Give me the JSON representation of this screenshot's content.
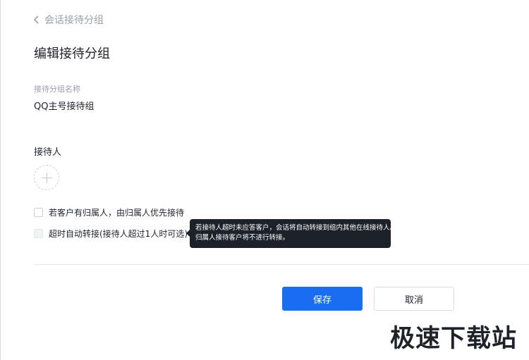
{
  "nav": {
    "back_label": "会话接待分组"
  },
  "page": {
    "title": "编辑接待分组"
  },
  "group_name": {
    "label": "接待分组名称",
    "value": "QQ主号接待组"
  },
  "receivers": {
    "label": "接待人"
  },
  "options": {
    "owner_priority": {
      "label": "若客户有归属人，由归属人优先接待",
      "checked": false
    },
    "auto_transfer": {
      "label": "超时自动转接(接待人超过1人时可选)",
      "checked": false,
      "disabled": true
    }
  },
  "tooltip": {
    "line1": "若接待人超时未应答客户，会话将自动转接到组内其他在线接待人。",
    "line2": "归属人接待客户将不进行转接。"
  },
  "actions": {
    "save_label": "保存",
    "cancel_label": "取消"
  },
  "watermark": {
    "text": "极速下载站"
  },
  "colors": {
    "primary": "#1a6cf0",
    "tooltip_bg": "#1d2129",
    "muted_text": "#9aa0a8"
  }
}
